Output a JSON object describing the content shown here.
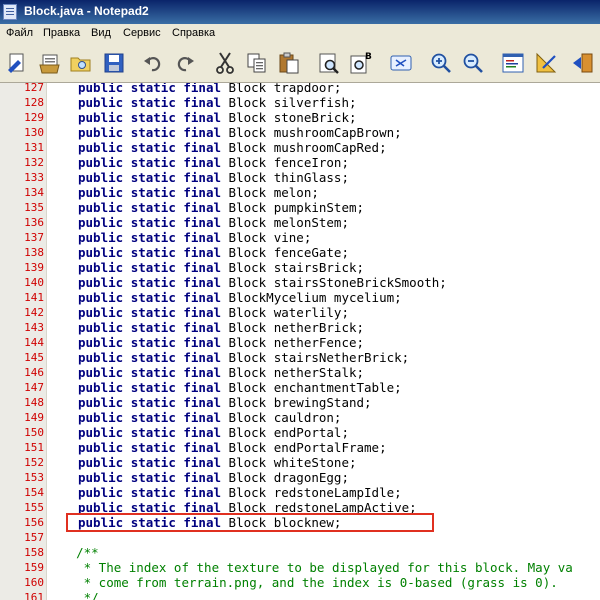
{
  "window": {
    "title": "Block.java - Notepad2"
  },
  "menu": [
    "Файл",
    "Правка",
    "Вид",
    "Сервис",
    "Справка"
  ],
  "toolbar": {
    "buttons": [
      {
        "name": "new-icon"
      },
      {
        "name": "open-icon"
      },
      {
        "name": "browse-icon"
      },
      {
        "name": "save-icon"
      },
      {
        "name": "undo-icon"
      },
      {
        "name": "redo-icon"
      },
      {
        "name": "cut-icon"
      },
      {
        "name": "copy-icon"
      },
      {
        "name": "paste-icon"
      },
      {
        "name": "find-icon"
      },
      {
        "name": "replace-icon"
      },
      {
        "name": "wordwrap-icon"
      },
      {
        "name": "zoom-in-icon"
      },
      {
        "name": "zoom-out-icon"
      },
      {
        "name": "scheme-icon"
      },
      {
        "name": "customize-icon"
      },
      {
        "name": "exit-icon"
      }
    ]
  },
  "editor": {
    "keywords": [
      "public",
      "static",
      "final"
    ],
    "lines": [
      {
        "n": "127",
        "type": "Block",
        "name": "trapdoor;"
      },
      {
        "n": "128",
        "type": "Block",
        "name": "silverfish;"
      },
      {
        "n": "129",
        "type": "Block",
        "name": "stoneBrick;"
      },
      {
        "n": "130",
        "type": "Block",
        "name": "mushroomCapBrown;"
      },
      {
        "n": "131",
        "type": "Block",
        "name": "mushroomCapRed;"
      },
      {
        "n": "132",
        "type": "Block",
        "name": "fenceIron;"
      },
      {
        "n": "133",
        "type": "Block",
        "name": "thinGlass;"
      },
      {
        "n": "134",
        "type": "Block",
        "name": "melon;"
      },
      {
        "n": "135",
        "type": "Block",
        "name": "pumpkinStem;"
      },
      {
        "n": "136",
        "type": "Block",
        "name": "melonStem;"
      },
      {
        "n": "137",
        "type": "Block",
        "name": "vine;"
      },
      {
        "n": "138",
        "type": "Block",
        "name": "fenceGate;"
      },
      {
        "n": "139",
        "type": "Block",
        "name": "stairsBrick;"
      },
      {
        "n": "140",
        "type": "Block",
        "name": "stairsStoneBrickSmooth;"
      },
      {
        "n": "141",
        "type": "BlockMycelium",
        "name": "mycelium;"
      },
      {
        "n": "142",
        "type": "Block",
        "name": "waterlily;"
      },
      {
        "n": "143",
        "type": "Block",
        "name": "netherBrick;"
      },
      {
        "n": "144",
        "type": "Block",
        "name": "netherFence;"
      },
      {
        "n": "145",
        "type": "Block",
        "name": "stairsNetherBrick;"
      },
      {
        "n": "146",
        "type": "Block",
        "name": "netherStalk;"
      },
      {
        "n": "147",
        "type": "Block",
        "name": "enchantmentTable;"
      },
      {
        "n": "148",
        "type": "Block",
        "name": "brewingStand;"
      },
      {
        "n": "149",
        "type": "Block",
        "name": "cauldron;"
      },
      {
        "n": "150",
        "type": "Block",
        "name": "endPortal;"
      },
      {
        "n": "151",
        "type": "Block",
        "name": "endPortalFrame;"
      },
      {
        "n": "152",
        "type": "Block",
        "name": "whiteStone;"
      },
      {
        "n": "153",
        "type": "Block",
        "name": "dragonEgg;"
      },
      {
        "n": "154",
        "type": "Block",
        "name": "redstoneLampIdle;"
      },
      {
        "n": "155",
        "type": "Block",
        "name": "redstoneLampActive;"
      },
      {
        "n": "156",
        "type": "Block",
        "name": "blocknew;",
        "highlight": true
      }
    ],
    "blank_line": "157",
    "comment_lines": [
      {
        "n": "158",
        "text": "    /**"
      },
      {
        "n": "159",
        "text": "     * The index of the texture to be displayed for this block. May va"
      },
      {
        "n": "160",
        "text": "     * come from terrain.png, and the index is 0-based (grass is 0)."
      },
      {
        "n": "161",
        "text": "     */"
      }
    ]
  },
  "colors": {
    "keyword": "#00007f",
    "line_number": "#d00000",
    "comment": "#008000",
    "highlight_border": "#e03020"
  }
}
